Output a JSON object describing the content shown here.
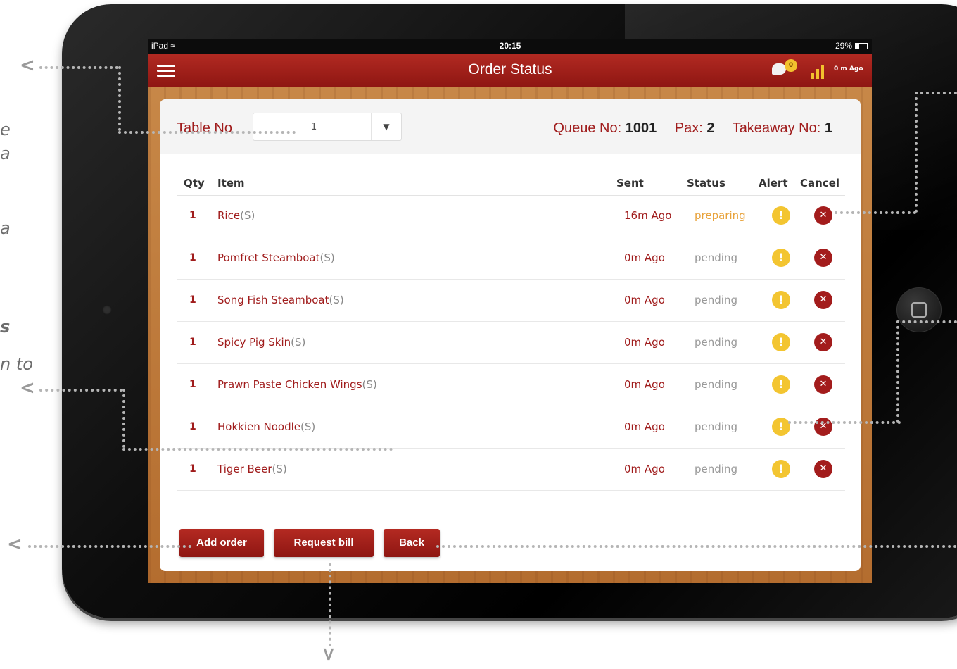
{
  "annotation_fragments": [
    "e",
    "a",
    "a",
    "s",
    "n to"
  ],
  "device": {
    "statusbar": {
      "carrier": "iPad",
      "time": "20:15",
      "battery": "29%"
    },
    "navbar": {
      "title": "Order Status",
      "chat_badge": "0",
      "last_update": "0 m Ago"
    }
  },
  "order": {
    "table_label": "Table No",
    "table_value": "1",
    "queue_label": "Queue No:",
    "queue_value": "1001",
    "pax_label": "Pax:",
    "pax_value": "2",
    "takeaway_label": "Takeaway No:",
    "takeaway_value": "1",
    "columns": [
      "Qty",
      "Item",
      "Sent",
      "Status",
      "Alert",
      "Cancel"
    ],
    "items": [
      {
        "qty": "1",
        "name": "Rice",
        "size": "(S)",
        "sent": "16m Ago",
        "status": "preparing"
      },
      {
        "qty": "1",
        "name": "Pomfret Steamboat",
        "size": "(S)",
        "sent": "0m Ago",
        "status": "pending"
      },
      {
        "qty": "1",
        "name": "Song Fish Steamboat",
        "size": "(S)",
        "sent": "0m Ago",
        "status": "pending"
      },
      {
        "qty": "1",
        "name": "Spicy Pig Skin",
        "size": "(S)",
        "sent": "0m Ago",
        "status": "pending"
      },
      {
        "qty": "1",
        "name": "Prawn Paste Chicken Wings",
        "size": "(S)",
        "sent": "0m Ago",
        "status": "pending"
      },
      {
        "qty": "1",
        "name": "Hokkien Noodle",
        "size": "(S)",
        "sent": "0m Ago",
        "status": "pending"
      },
      {
        "qty": "1",
        "name": "Tiger Beer",
        "size": "(S)",
        "sent": "0m Ago",
        "status": "pending"
      }
    ],
    "buttons": {
      "add": "Add order",
      "bill": "Request bill",
      "back": "Back"
    }
  },
  "colors": {
    "brand_red": "#a01c1c",
    "alert_yellow": "#f3c531",
    "preparing_orange": "#e8a23a"
  }
}
